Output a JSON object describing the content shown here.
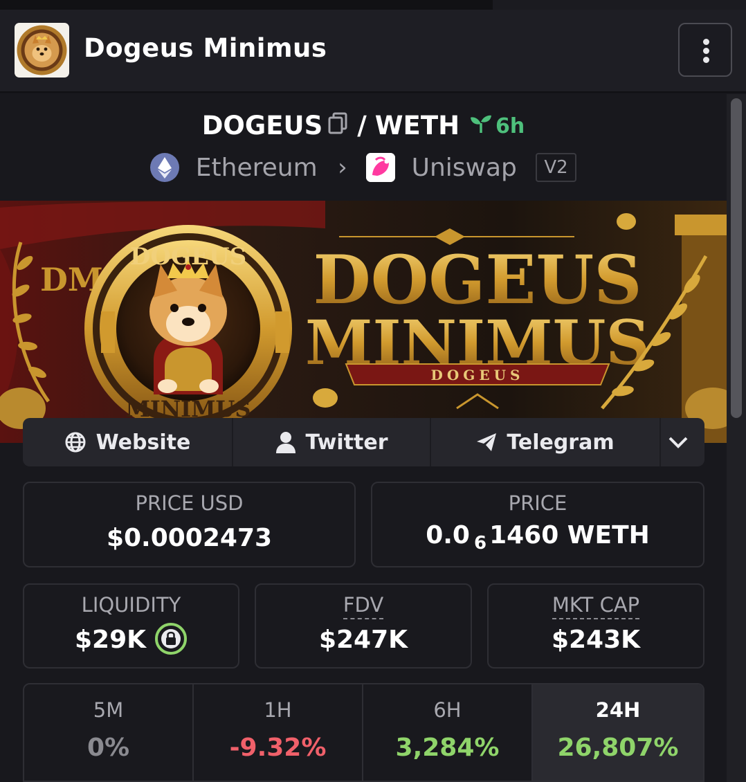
{
  "header": {
    "token_name": "Dogeus Minimus",
    "menu_icon": "vertical-dots-icon"
  },
  "pair": {
    "base": "DOGEUS",
    "separator": "/",
    "quote": "WETH",
    "age": "6h",
    "age_icon": "sprout-icon"
  },
  "chain": {
    "name": "Ethereum",
    "dex": "Uniswap",
    "version": "V2"
  },
  "banner": {
    "title_line1": "DOGEUS",
    "title_line2": "MINIMUS",
    "ribbon": "DOGEUS",
    "coin_top": "DOGEUS",
    "coin_bottom": "MINIMUS",
    "monogram": "DM"
  },
  "links": {
    "website": "Website",
    "twitter": "Twitter",
    "telegram": "Telegram"
  },
  "stats": {
    "price_usd_label": "PRICE USD",
    "price_usd": "$0.0002473",
    "price_label": "PRICE",
    "price_prefix": "0.0",
    "price_zero_count": "6",
    "price_suffix": "1460 WETH",
    "liquidity_label": "LIQUIDITY",
    "liquidity": "$29K",
    "fdv_label": "FDV",
    "fdv": "$247K",
    "mkt_cap_label": "MKT CAP",
    "mkt_cap": "$243K"
  },
  "changes": [
    {
      "period": "5M",
      "value": "0%",
      "color": "#8a8a90"
    },
    {
      "period": "1H",
      "value": "-9.32%",
      "color": "#f0606a"
    },
    {
      "period": "6H",
      "value": "3,284%",
      "color": "#8fd46a"
    },
    {
      "period": "24H",
      "value": "26,807%",
      "color": "#8fd46a"
    }
  ],
  "colors": {
    "positive": "#8fd46a",
    "negative": "#f0606a",
    "accent_green": "#4ec07c",
    "lock_ring": "#8fd46a"
  }
}
